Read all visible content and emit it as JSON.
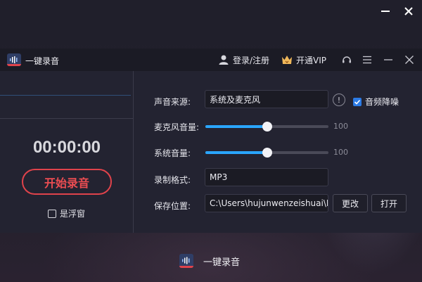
{
  "window": {
    "minimize_icon": "minimize-icon",
    "close_icon": "close-icon"
  },
  "titlebar": {
    "app_name": "一键录音",
    "login_label": "登录/注册",
    "vip_label": "开通VIP",
    "icons": [
      "logo-icon",
      "user-icon",
      "crown-icon",
      "support-icon",
      "menu-icon",
      "minimize-icon",
      "close-icon"
    ]
  },
  "recorder": {
    "timer": "00:00:00",
    "start_label": "开始录音",
    "float_label": "是浮窗",
    "float_checked": false
  },
  "settings": {
    "source_label": "声音来源:",
    "source_value": "系统及麦克风",
    "denoise_label": "音频降噪",
    "denoise_checked": true,
    "info_symbol": "!",
    "mic_label": "麦克风音量:",
    "mic_volume": 100,
    "mic_fraction": 0.5,
    "sys_label": "系统音量:",
    "sys_volume": 100,
    "sys_fraction": 0.5,
    "format_label": "录制格式:",
    "format_value": "MP3",
    "path_label": "保存位置:",
    "path_value": "C:\\Users\\hujunwenzeishuai\\De",
    "change_label": "更改",
    "open_label": "打开"
  },
  "footer": {
    "app_name": "一键录音"
  },
  "colors": {
    "accent_blue": "#2aa6ff",
    "record_red": "#e0434b",
    "checkbox_blue": "#2c7be5"
  }
}
